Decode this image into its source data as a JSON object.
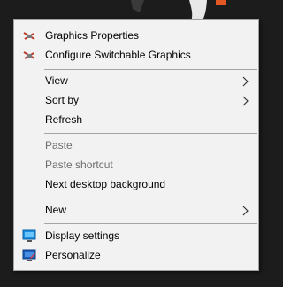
{
  "menu": {
    "items": [
      {
        "label": "Graphics Properties",
        "icon": "intel-graphics-icon"
      },
      {
        "label": "Configure Switchable Graphics",
        "icon": "intel-graphics-icon"
      },
      {
        "label": "View",
        "submenu": true
      },
      {
        "label": "Sort by",
        "submenu": true
      },
      {
        "label": "Refresh"
      },
      {
        "label": "Paste",
        "disabled": true
      },
      {
        "label": "Paste shortcut",
        "disabled": true
      },
      {
        "label": "Next desktop background"
      },
      {
        "label": "New",
        "submenu": true
      },
      {
        "label": "Display settings",
        "icon": "display-settings-icon"
      },
      {
        "label": "Personalize",
        "icon": "personalize-icon"
      }
    ]
  },
  "colors": {
    "menu_background": "#f2f2f2",
    "menu_border": "#a0a0a0",
    "separator": "#a6a6a6",
    "disabled_text": "#6d6d6d",
    "desktop_background": "#1c1c1c",
    "accent": "#1d8fe0"
  }
}
